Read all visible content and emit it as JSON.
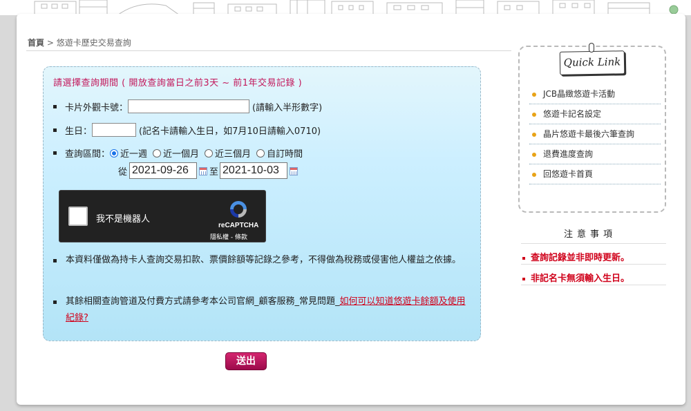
{
  "breadcrumb": {
    "home": "首頁",
    "separator": ">",
    "current": "悠遊卡歷史交易查詢"
  },
  "form": {
    "title": "請選擇查詢期間 ( 開放查詢當日之前3天 ~ 前1年交易記錄 )",
    "card_label": "卡片外觀卡號：",
    "card_value": "",
    "card_hint": "(請輸入半形數字)",
    "birthday_label": "生日：",
    "birthday_value": "",
    "birthday_hint": "(記名卡請輸入生日，如7月10日請輸入0710)",
    "range_label": "查詢區間：",
    "range_options": [
      "近一週",
      "近一個月",
      "近三個月",
      "自訂時間"
    ],
    "range_selected": "近一週",
    "from_label": "從",
    "from_date": "2021-09-26",
    "to_label": "至",
    "to_date": "2021-10-03"
  },
  "captcha": {
    "label": "我不是機器人",
    "brand": "reCAPTCHA",
    "links": "隱私權 - 條款"
  },
  "notes": {
    "note1": "本資料僅做為持卡人查詢交易扣款、票價餘額等記錄之參考，不得做為稅務或侵害他人權益之依據。",
    "note2_prefix": "其餘相關查詢管道及付費方式請參考本公司官網_顧客服務_常見問題_",
    "note2_link": "如何可以知道悠遊卡餘額及使用紀錄?"
  },
  "submit_label": "送出",
  "quick_link": {
    "title": "Quick Link",
    "items": [
      "JCB晶緻悠遊卡活動",
      "悠遊卡記名設定",
      "晶片悠遊卡最後六筆查詢",
      "退費進度查詢",
      "回悠遊卡首頁"
    ]
  },
  "notice": {
    "title": "注意事項",
    "items": [
      "查詢記錄並非即時更新。",
      "非記名卡無須輸入生日。"
    ]
  },
  "colors": {
    "accent": "#c2185b",
    "submit": "#b0105a",
    "link": "#d0021b",
    "form_bg": "#bfeaf7",
    "bullet_orange": "#e8a317"
  }
}
